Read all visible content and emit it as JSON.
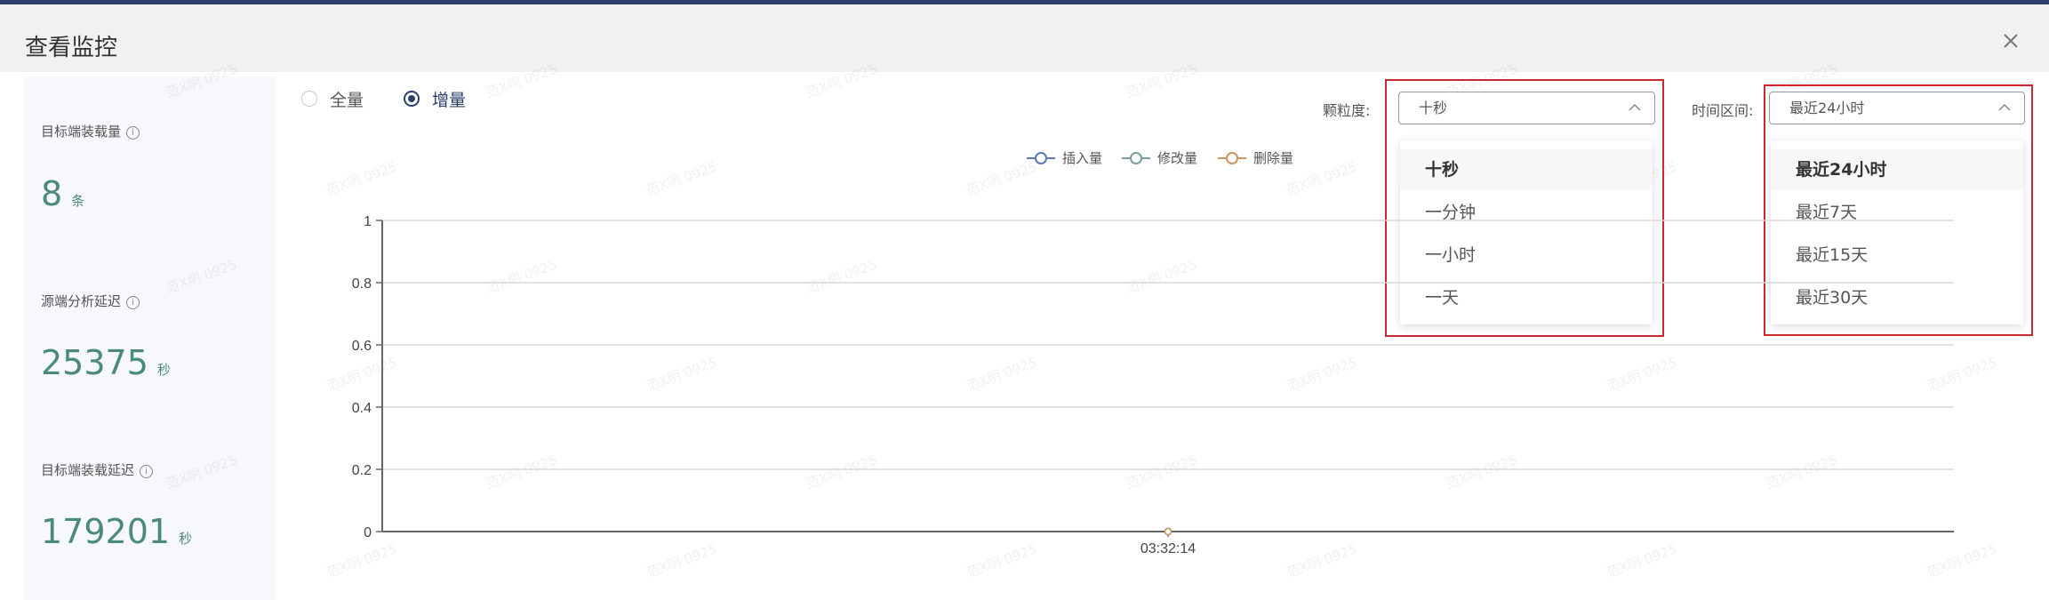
{
  "dialog": {
    "title": "查看监控"
  },
  "stats": [
    {
      "label": "目标端装载量",
      "value": "8",
      "unit": "条"
    },
    {
      "label": "源端分析延迟",
      "value": "25375",
      "unit": "秒"
    },
    {
      "label": "目标端装载延迟",
      "value": "179201",
      "unit": "秒"
    }
  ],
  "mode": {
    "options": [
      "全量",
      "增量"
    ],
    "selected": "增量"
  },
  "granularity": {
    "label": "颗粒度:",
    "value": "十秒",
    "options": [
      "十秒",
      "一分钟",
      "一小时",
      "一天"
    ]
  },
  "time_range": {
    "label": "时间区间:",
    "value": "最近24小时",
    "options": [
      "最近24小时",
      "最近7天",
      "最近15天",
      "最近30天"
    ]
  },
  "watermark_text": "范X明 0925",
  "colors": {
    "accent": "#2c3f6e",
    "stat_value": "#4a8a7c",
    "highlight": "#c8282e"
  },
  "chart_data": {
    "type": "line",
    "x": [
      "03:32:14"
    ],
    "series": [
      {
        "name": "插入量",
        "values": [
          0
        ],
        "color": "#5b7ab8"
      },
      {
        "name": "修改量",
        "values": [
          0
        ],
        "color": "#7a9ea0"
      },
      {
        "name": "删除量",
        "values": [
          0
        ],
        "color": "#c9955b"
      }
    ],
    "yticks": [
      "0",
      "0.2",
      "0.4",
      "0.6",
      "0.8",
      "1"
    ],
    "ylim": [
      0,
      1
    ],
    "grid": true,
    "legend": "top-center"
  }
}
